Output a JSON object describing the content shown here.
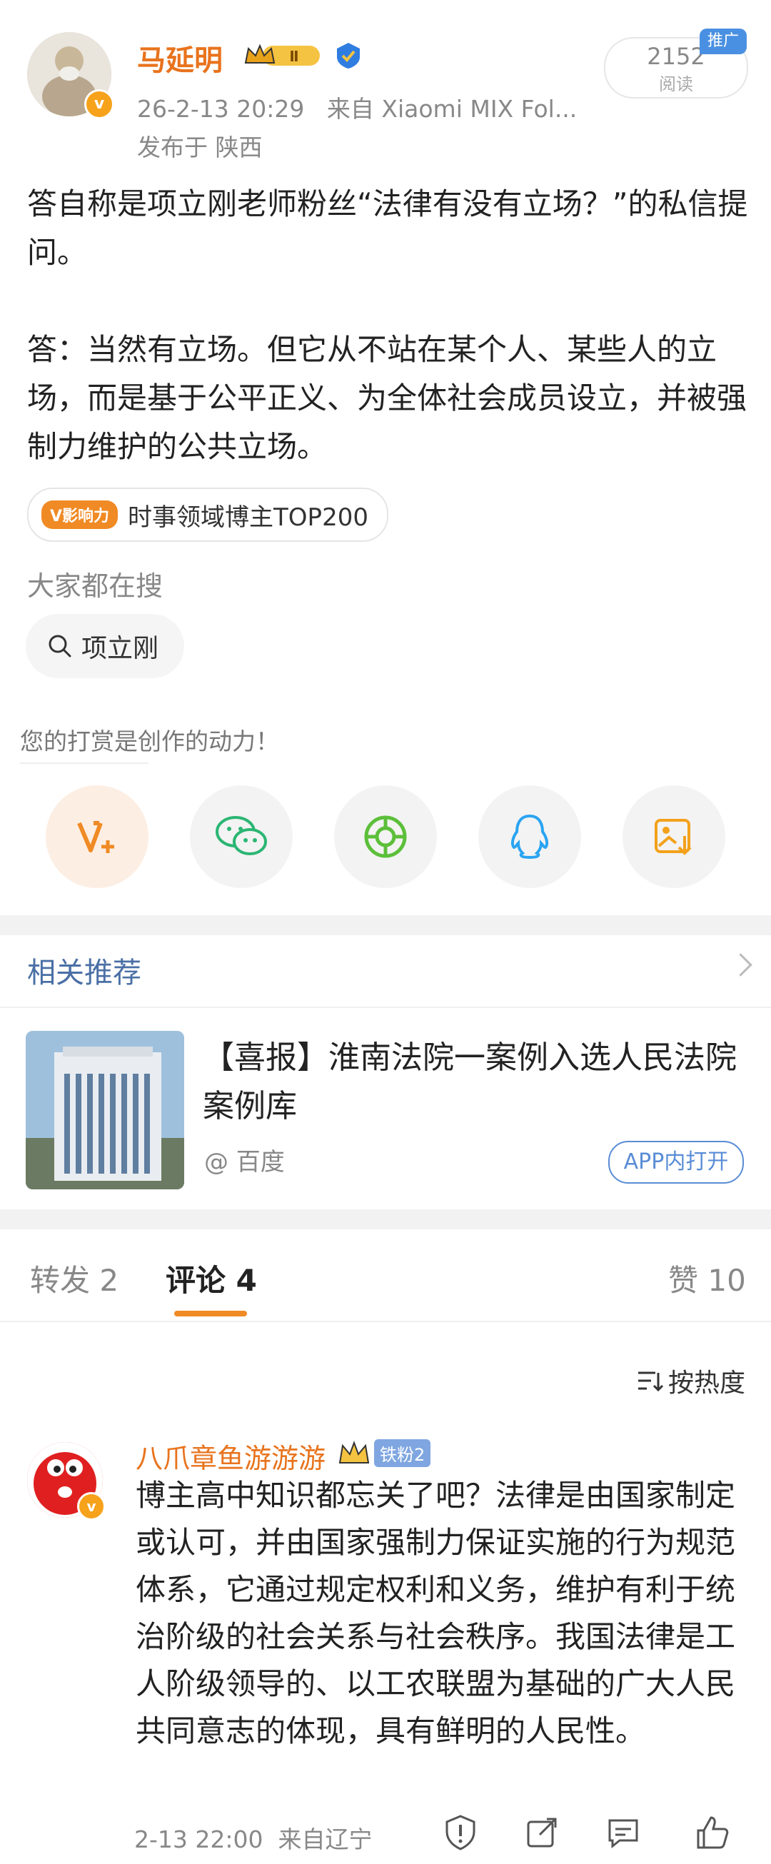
{
  "author": {
    "name": "马延明",
    "level_badge": "Ⅱ",
    "time": "26-2-13 20:29",
    "source": "来自 Xiaomi MIX Fol...",
    "location": "发布于 陕西",
    "read_count": "2152",
    "read_label": "阅读",
    "promo_tag": "推广"
  },
  "post": {
    "para1": "答自称是项立刚老师粉丝“法律有没有立场？”的私信提问。",
    "para2": "答：当然有立场。但它从不站在某个人、某些人的立场，而是基于公平正义、为全体社会成员设立，并被强制力维护的公共立场。"
  },
  "influence": {
    "badge": "V影响力",
    "text": "时事领域博主TOP200"
  },
  "search": {
    "title": "大家都在搜",
    "chip": "项立刚"
  },
  "reward": {
    "text": "您的打赏是创作的动力！"
  },
  "share_icons": [
    "reward-v-icon",
    "wechat-icon",
    "moments-icon",
    "qq-icon",
    "save-image-icon"
  ],
  "related": {
    "title": "相关推荐",
    "news_title": "【喜报】淮南法院一案例入选人民法院案例库",
    "news_source": "@ 百度",
    "open_app": "APP内打开"
  },
  "tabs": {
    "repost": "转发 2",
    "comment": "评论 4",
    "like": "赞 10"
  },
  "sort": {
    "label": "按热度"
  },
  "comment": {
    "name": "八爪章鱼游游游",
    "fan_badge": "铁粉2",
    "text": "博主高中知识都忘关了吧？法律是由国家制定或认可，并由国家强制力保证实施的行为规范体系，它通过规定权利和义务，维护有利于统治阶级的社会关系与社会秩序。我国法律是工人阶级领导的、以工农联盟为基础的广大人民共同意志的体现，具有鲜明的人民性。",
    "time": "2-13 22:00",
    "location": "来自辽宁"
  },
  "colors": {
    "accent_orange": "#f08a24",
    "author_orange": "#e8731d",
    "link_blue": "#4a6fa5"
  }
}
